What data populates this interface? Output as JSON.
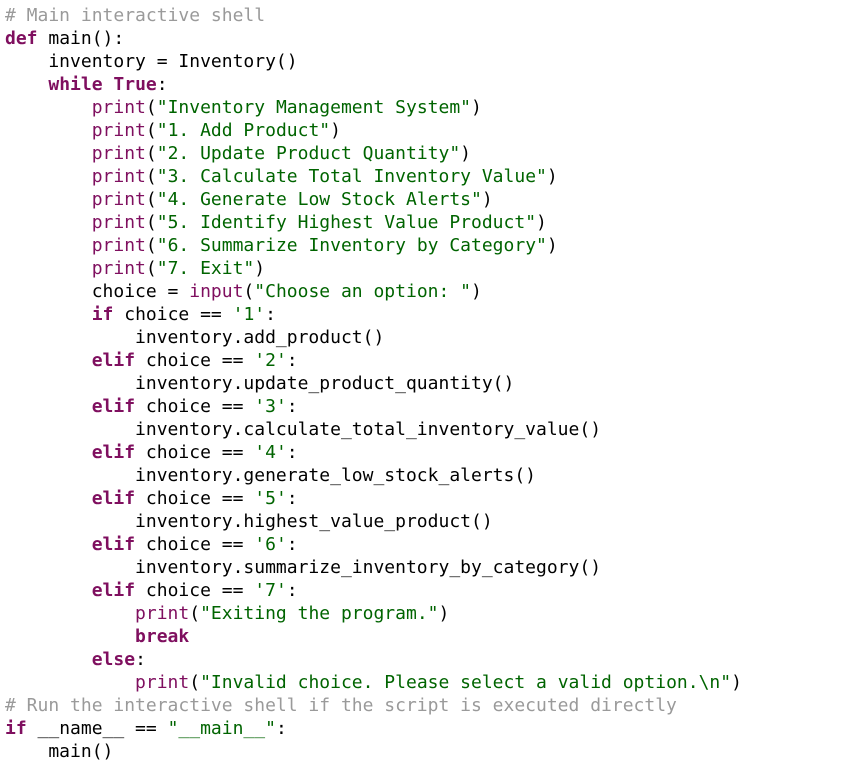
{
  "editor": {
    "lines": [
      [
        {
          "t": "# Main interactive shell",
          "k": "comment"
        }
      ],
      [
        {
          "t": "def",
          "k": "kw"
        },
        {
          "t": " main",
          "k": "default"
        },
        {
          "t": "():",
          "k": "default"
        }
      ],
      [
        {
          "t": "    inventory = Inventory()",
          "k": "default"
        }
      ],
      [
        {
          "t": "    ",
          "k": "default"
        },
        {
          "t": "while",
          "k": "kw"
        },
        {
          "t": " ",
          "k": "default"
        },
        {
          "t": "True",
          "k": "kw"
        },
        {
          "t": ":",
          "k": "default"
        }
      ],
      [
        {
          "t": "        ",
          "k": "default"
        },
        {
          "t": "print",
          "k": "fn"
        },
        {
          "t": "(",
          "k": "default"
        },
        {
          "t": "\"Inventory Management System\"",
          "k": "str"
        },
        {
          "t": ")",
          "k": "default"
        }
      ],
      [
        {
          "t": "        ",
          "k": "default"
        },
        {
          "t": "print",
          "k": "fn"
        },
        {
          "t": "(",
          "k": "default"
        },
        {
          "t": "\"1. Add Product\"",
          "k": "str"
        },
        {
          "t": ")",
          "k": "default"
        }
      ],
      [
        {
          "t": "        ",
          "k": "default"
        },
        {
          "t": "print",
          "k": "fn"
        },
        {
          "t": "(",
          "k": "default"
        },
        {
          "t": "\"2. Update Product Quantity\"",
          "k": "str"
        },
        {
          "t": ")",
          "k": "default"
        }
      ],
      [
        {
          "t": "        ",
          "k": "default"
        },
        {
          "t": "print",
          "k": "fn"
        },
        {
          "t": "(",
          "k": "default"
        },
        {
          "t": "\"3. Calculate Total Inventory Value\"",
          "k": "str"
        },
        {
          "t": ")",
          "k": "default"
        }
      ],
      [
        {
          "t": "        ",
          "k": "default"
        },
        {
          "t": "print",
          "k": "fn"
        },
        {
          "t": "(",
          "k": "default"
        },
        {
          "t": "\"4. Generate Low Stock Alerts\"",
          "k": "str"
        },
        {
          "t": ")",
          "k": "default"
        }
      ],
      [
        {
          "t": "        ",
          "k": "default"
        },
        {
          "t": "print",
          "k": "fn"
        },
        {
          "t": "(",
          "k": "default"
        },
        {
          "t": "\"5. Identify Highest Value Product\"",
          "k": "str"
        },
        {
          "t": ")",
          "k": "default"
        }
      ],
      [
        {
          "t": "        ",
          "k": "default"
        },
        {
          "t": "print",
          "k": "fn"
        },
        {
          "t": "(",
          "k": "default"
        },
        {
          "t": "\"6. Summarize Inventory by Category\"",
          "k": "str"
        },
        {
          "t": ")",
          "k": "default"
        }
      ],
      [
        {
          "t": "        ",
          "k": "default"
        },
        {
          "t": "print",
          "k": "fn"
        },
        {
          "t": "(",
          "k": "default"
        },
        {
          "t": "\"7. Exit\"",
          "k": "str"
        },
        {
          "t": ")",
          "k": "default"
        }
      ],
      [
        {
          "t": "        choice = ",
          "k": "default"
        },
        {
          "t": "input",
          "k": "fn"
        },
        {
          "t": "(",
          "k": "default"
        },
        {
          "t": "\"Choose an option: \"",
          "k": "str"
        },
        {
          "t": ")",
          "k": "default"
        }
      ],
      [
        {
          "t": "        ",
          "k": "default"
        },
        {
          "t": "if",
          "k": "kw"
        },
        {
          "t": " choice == ",
          "k": "default"
        },
        {
          "t": "'1'",
          "k": "str"
        },
        {
          "t": ":",
          "k": "default"
        }
      ],
      [
        {
          "t": "            inventory.add_product()",
          "k": "default"
        }
      ],
      [
        {
          "t": "        ",
          "k": "default"
        },
        {
          "t": "elif",
          "k": "kw"
        },
        {
          "t": " choice == ",
          "k": "default"
        },
        {
          "t": "'2'",
          "k": "str"
        },
        {
          "t": ":",
          "k": "default"
        }
      ],
      [
        {
          "t": "            inventory.update_product_quantity()",
          "k": "default"
        }
      ],
      [
        {
          "t": "        ",
          "k": "default"
        },
        {
          "t": "elif",
          "k": "kw"
        },
        {
          "t": " choice == ",
          "k": "default"
        },
        {
          "t": "'3'",
          "k": "str"
        },
        {
          "t": ":",
          "k": "default"
        }
      ],
      [
        {
          "t": "            inventory.calculate_total_inventory_value()",
          "k": "default"
        }
      ],
      [
        {
          "t": "        ",
          "k": "default"
        },
        {
          "t": "elif",
          "k": "kw"
        },
        {
          "t": " choice == ",
          "k": "default"
        },
        {
          "t": "'4'",
          "k": "str"
        },
        {
          "t": ":",
          "k": "default"
        }
      ],
      [
        {
          "t": "            inventory.generate_low_stock_alerts()",
          "k": "default"
        }
      ],
      [
        {
          "t": "        ",
          "k": "default"
        },
        {
          "t": "elif",
          "k": "kw"
        },
        {
          "t": " choice == ",
          "k": "default"
        },
        {
          "t": "'5'",
          "k": "str"
        },
        {
          "t": ":",
          "k": "default"
        }
      ],
      [
        {
          "t": "            inventory.highest_value_product()",
          "k": "default"
        }
      ],
      [
        {
          "t": "        ",
          "k": "default"
        },
        {
          "t": "elif",
          "k": "kw"
        },
        {
          "t": " choice == ",
          "k": "default"
        },
        {
          "t": "'6'",
          "k": "str"
        },
        {
          "t": ":",
          "k": "default"
        }
      ],
      [
        {
          "t": "            inventory.summarize_inventory_by_category()",
          "k": "default"
        }
      ],
      [
        {
          "t": "        ",
          "k": "default"
        },
        {
          "t": "elif",
          "k": "kw"
        },
        {
          "t": " choice == ",
          "k": "default"
        },
        {
          "t": "'7'",
          "k": "str"
        },
        {
          "t": ":",
          "k": "default"
        }
      ],
      [
        {
          "t": "            ",
          "k": "default"
        },
        {
          "t": "print",
          "k": "fn"
        },
        {
          "t": "(",
          "k": "default"
        },
        {
          "t": "\"Exiting the program.\"",
          "k": "str"
        },
        {
          "t": ")",
          "k": "default"
        }
      ],
      [
        {
          "t": "            ",
          "k": "default"
        },
        {
          "t": "break",
          "k": "kw"
        }
      ],
      [
        {
          "t": "        ",
          "k": "default"
        },
        {
          "t": "else",
          "k": "kw"
        },
        {
          "t": ":",
          "k": "default"
        }
      ],
      [
        {
          "t": "            ",
          "k": "default"
        },
        {
          "t": "print",
          "k": "fn"
        },
        {
          "t": "(",
          "k": "default"
        },
        {
          "t": "\"Invalid choice. Please select a valid option.\\n\"",
          "k": "str"
        },
        {
          "t": ")",
          "k": "default"
        }
      ],
      [
        {
          "t": "# Run the interactive shell if the script is executed directly",
          "k": "comment"
        }
      ],
      [
        {
          "t": "if",
          "k": "kw"
        },
        {
          "t": " __name__ == ",
          "k": "default"
        },
        {
          "t": "\"__main__\"",
          "k": "str"
        },
        {
          "t": ":",
          "k": "default"
        }
      ],
      [
        {
          "t": "    main()",
          "k": "default"
        }
      ]
    ]
  },
  "colors": {
    "keyword": "#7f0f5f",
    "builtin": "#7f0f5f",
    "string": "#006400",
    "comment": "#9a9a9a",
    "default": "#000000",
    "background": "#ffffff"
  }
}
